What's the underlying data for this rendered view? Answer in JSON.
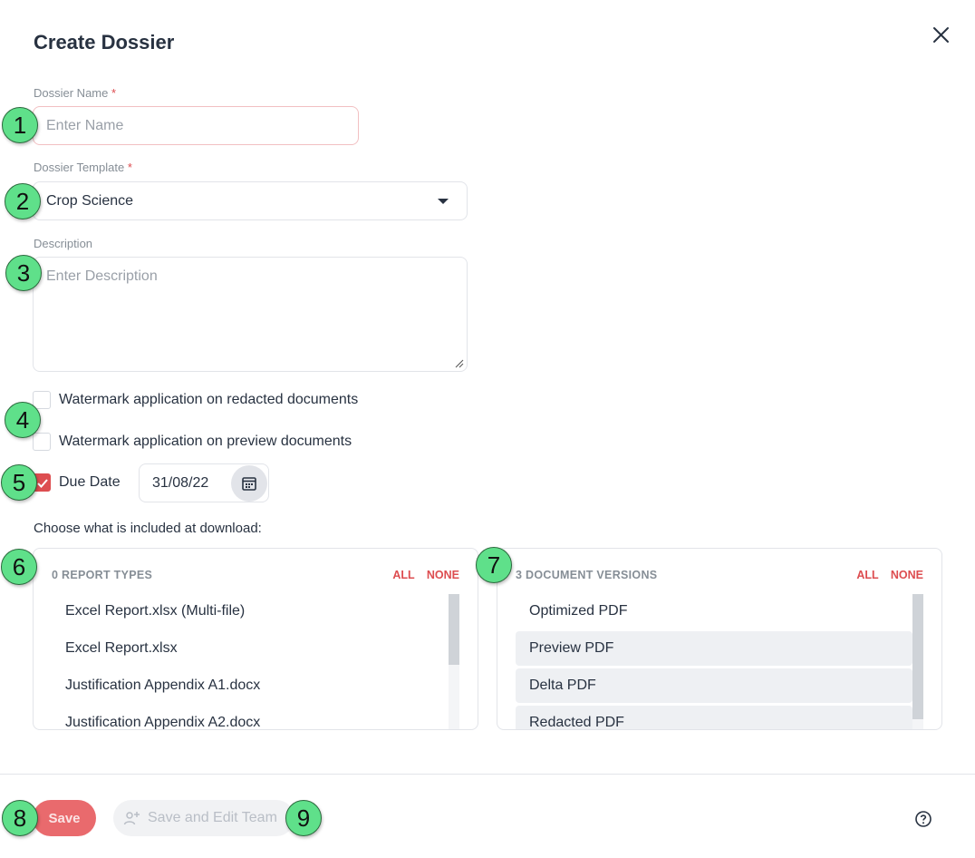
{
  "dialog": {
    "title": "Create Dossier",
    "close_icon": "close-icon"
  },
  "form": {
    "name": {
      "label": "Dossier Name",
      "required_mark": "*",
      "placeholder": "Enter Name",
      "value": ""
    },
    "template": {
      "label": "Dossier Template",
      "required_mark": "*",
      "value": "Crop Science"
    },
    "description": {
      "label": "Description",
      "placeholder": "Enter Description",
      "value": ""
    },
    "watermark_redacted": {
      "label": "Watermark application on redacted documents",
      "checked": false
    },
    "watermark_preview": {
      "label": "Watermark application on preview documents",
      "checked": false
    },
    "due_date": {
      "label": "Due Date",
      "checked": true,
      "value": "31/08/22"
    }
  },
  "download": {
    "heading": "Choose what is included at download:",
    "report_types": {
      "count_label": "0 REPORT TYPES",
      "all_label": "ALL",
      "none_label": "NONE",
      "items": [
        {
          "label": "Excel Report.xlsx (Multi-file)",
          "selected": false
        },
        {
          "label": "Excel Report.xlsx",
          "selected": false
        },
        {
          "label": "Justification Appendix A1.docx",
          "selected": false
        },
        {
          "label": "Justification Appendix A2.docx",
          "selected": false
        }
      ]
    },
    "document_versions": {
      "count_label": "3 DOCUMENT VERSIONS",
      "all_label": "ALL",
      "none_label": "NONE",
      "items": [
        {
          "label": "Optimized PDF",
          "selected": false
        },
        {
          "label": "Preview PDF",
          "selected": true
        },
        {
          "label": "Delta PDF",
          "selected": true
        },
        {
          "label": "Redacted PDF",
          "selected": true
        }
      ]
    }
  },
  "footer": {
    "save_label": "Save",
    "save_team_label": "Save and Edit Team",
    "help_icon": "help-circle-icon"
  },
  "annotations": [
    "1",
    "2",
    "3",
    "4",
    "5",
    "6",
    "7",
    "8",
    "9"
  ],
  "colors": {
    "accent": "#dd4d50",
    "badge": "#5fe08a",
    "text": "#283241",
    "muted": "#868e96",
    "border": "#e2e4e9"
  }
}
